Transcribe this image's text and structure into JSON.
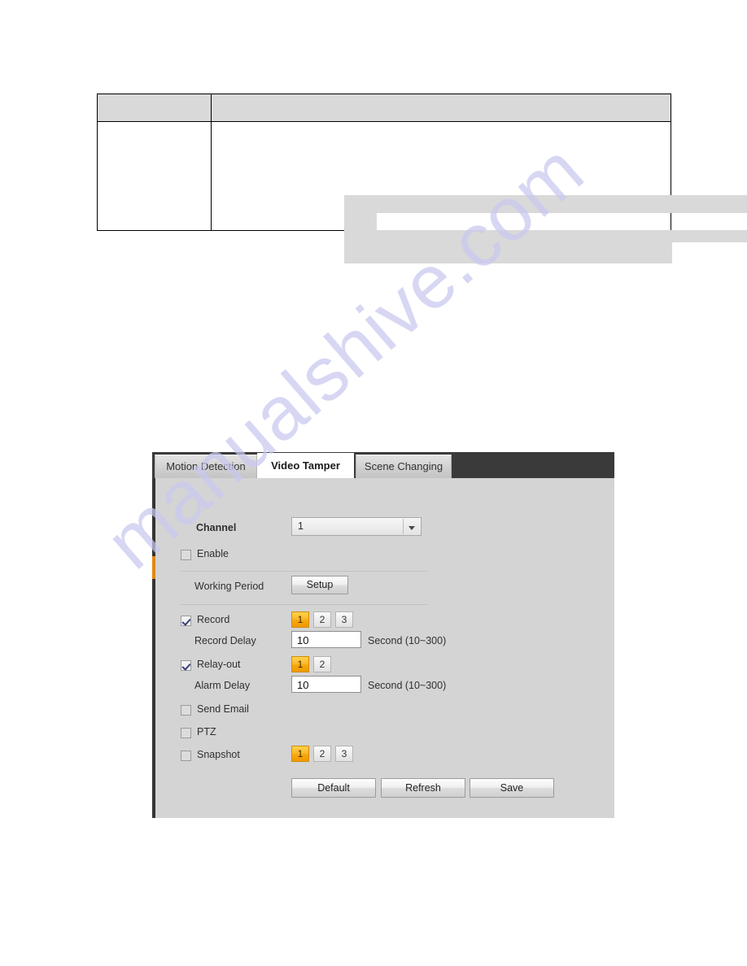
{
  "watermark": {
    "text": "manualshive.com"
  },
  "doc_table": {
    "header": {
      "col1": "",
      "col2": ""
    },
    "row": {
      "col1": "",
      "col2": ""
    }
  },
  "panel": {
    "tabs": [
      {
        "label": "Motion Detection",
        "active": false
      },
      {
        "label": "Video Tamper",
        "active": true
      },
      {
        "label": "Scene Changing",
        "active": false
      }
    ],
    "channel": {
      "label": "Channel",
      "value": "1",
      "options": [
        "1"
      ]
    },
    "enable": {
      "label": "Enable",
      "checked": false
    },
    "working_period": {
      "label": "Working Period",
      "button_label": "Setup"
    },
    "record": {
      "label": "Record",
      "checked": true,
      "channels": [
        "1",
        "2",
        "3"
      ],
      "selected": "1"
    },
    "record_delay": {
      "label": "Record Delay",
      "value": "10",
      "unit": "Second (10~300)"
    },
    "relay_out": {
      "label": "Relay-out",
      "checked": true,
      "channels": [
        "1",
        "2"
      ],
      "selected": "1"
    },
    "alarm_delay": {
      "label": "Alarm Delay",
      "value": "10",
      "unit": "Second (10~300)"
    },
    "send_email": {
      "label": "Send Email",
      "checked": false
    },
    "ptz": {
      "label": "PTZ",
      "checked": false
    },
    "snapshot": {
      "label": "Snapshot",
      "checked": false,
      "channels": [
        "1",
        "2",
        "3"
      ],
      "selected": "1"
    },
    "actions": {
      "default_label": "Default",
      "refresh_label": "Refresh",
      "save_label": "Save"
    },
    "colors": {
      "accent_orange": "#f7a80f",
      "tabbar_dark": "#3a3a3a",
      "panel_gray": "#d4d4d4",
      "watermark_blue": "#c9c9f0"
    }
  }
}
